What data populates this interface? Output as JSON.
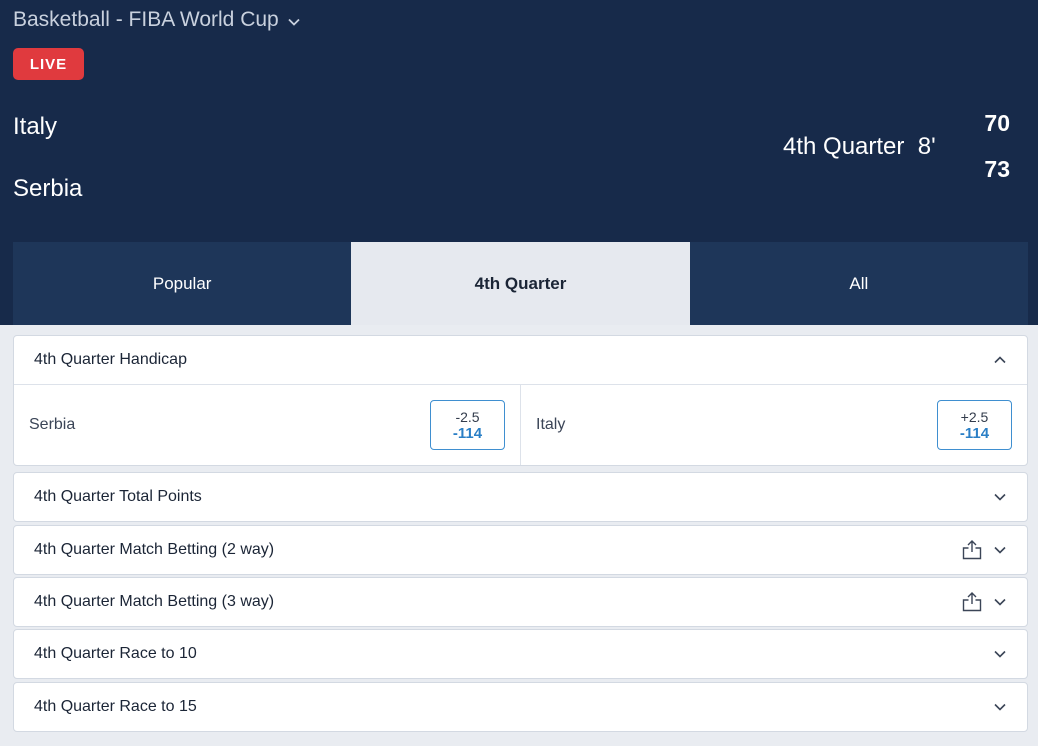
{
  "header": {
    "competition": "Basketball - FIBA World Cup",
    "live_label": "LIVE",
    "home_team": "Italy",
    "away_team": "Serbia",
    "period": "4th Quarter  8'",
    "home_score": "70",
    "away_score": "73"
  },
  "tabs": [
    {
      "label": "Popular"
    },
    {
      "label": "4th Quarter"
    },
    {
      "label": "All"
    }
  ],
  "markets": {
    "handicap": {
      "title": "4th Quarter Handicap",
      "selections": [
        {
          "team": "Serbia",
          "line": "-2.5",
          "price": "-114"
        },
        {
          "team": "Italy",
          "line": "+2.5",
          "price": "-114"
        }
      ]
    },
    "total_points": {
      "title": "4th Quarter Total Points"
    },
    "match_2way": {
      "title": "4th Quarter Match Betting (2 way)"
    },
    "match_3way": {
      "title": "4th Quarter Match Betting (3 way)"
    },
    "race_10": {
      "title": "4th Quarter Race to 10"
    },
    "race_15": {
      "title": "4th Quarter Race to 15"
    }
  },
  "colors": {
    "header_bg": "#172a4a",
    "tab_bg": "#1e3659",
    "live_red": "#e03a3e",
    "odds_blue": "#2a7fc6"
  }
}
